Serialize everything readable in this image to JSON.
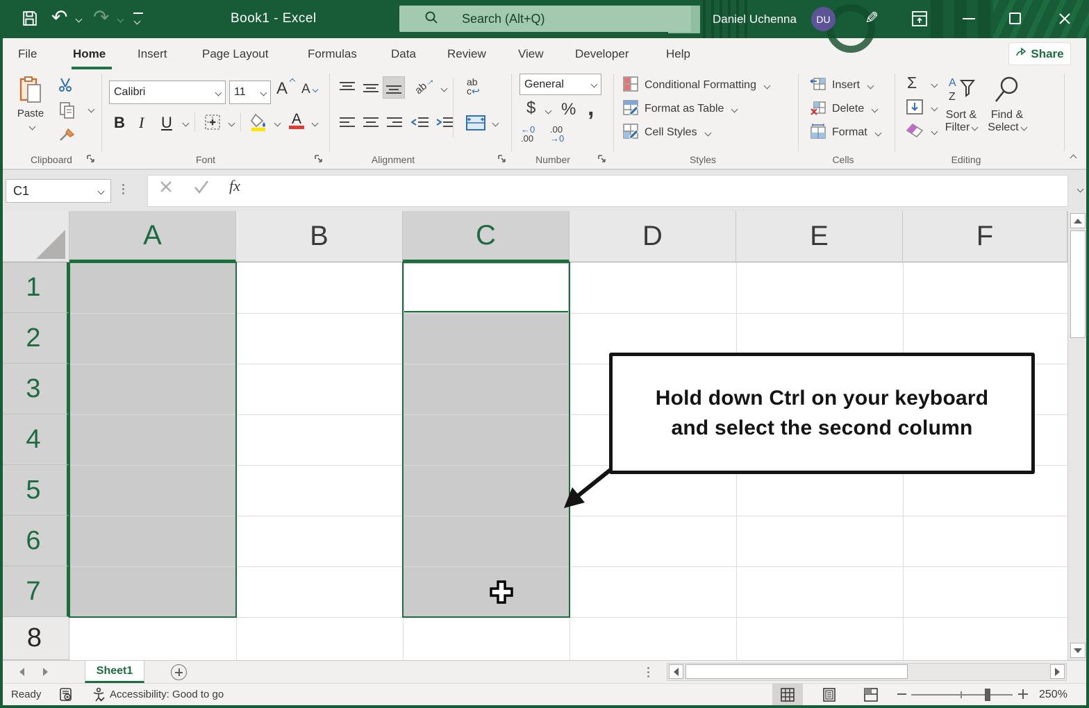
{
  "title_bar": {
    "title": "Book1  -  Excel",
    "undo_glyph": "↶",
    "redo_glyph": "↷",
    "pen_glyph": "✎",
    "search_placeholder": "Search (Alt+Q)",
    "user_name": "Daniel Uchenna",
    "avatar_initials": "DU"
  },
  "tabs": {
    "items": [
      "File",
      "Home",
      "Insert",
      "Page Layout",
      "Formulas",
      "Data",
      "Review",
      "View",
      "Developer",
      "Help"
    ],
    "active": "Home",
    "share_label": "Share"
  },
  "ribbon": {
    "clipboard": {
      "label": "Clipboard",
      "paste_label": "Paste"
    },
    "font": {
      "label": "Font",
      "name": "Calibri",
      "size": "11",
      "bold": "B",
      "italic": "I",
      "underline": "U",
      "grow": "A",
      "shrink": "A"
    },
    "alignment": {
      "label": "Alignment",
      "orient_ab": "ab",
      "wrap_l1": "ab",
      "wrap_l2": "c"
    },
    "number": {
      "label": "Number",
      "format": "General",
      "currency": "$",
      "percent": "%",
      "comma": ",",
      "inc1": "←0",
      "inc2": ".00",
      "dec1": ".00",
      "dec2": "→0"
    },
    "styles": {
      "label": "Styles",
      "conditional_formatting": "Conditional Formatting",
      "format_as_table": "Format as Table",
      "cell_styles": "Cell Styles"
    },
    "cells": {
      "label": "Cells",
      "insert": "Insert",
      "delete": "Delete",
      "format": "Format"
    },
    "editing": {
      "label": "Editing",
      "autosum": "Σ",
      "sort1": "Sort &",
      "sort2": "Filter",
      "find1": "Find &",
      "find2": "Select"
    }
  },
  "formula_bar": {
    "name_box": "C1",
    "fx": "fx"
  },
  "grid": {
    "columns": [
      "A",
      "B",
      "C",
      "D",
      "E",
      "F"
    ],
    "rows": [
      "1",
      "2",
      "3",
      "4",
      "5",
      "6",
      "7",
      "8"
    ],
    "selected_columns": [
      "A",
      "C"
    ],
    "active_cell": "C1"
  },
  "callout": {
    "line1": "Hold down Ctrl on your keyboard",
    "line2": "and select the second column"
  },
  "sheet_bar": {
    "tab": "Sheet1"
  },
  "status_bar": {
    "ready": "Ready",
    "accessibility": "Accessibility: Good to go",
    "zoom": "250%"
  },
  "colors": {
    "titlebar_green": "#185c37",
    "accent_green": "#1a6e3f",
    "selection_gray": "#cbcbcb",
    "avatar_purple": "#5d5397",
    "search_bg": "#a3c9b0"
  }
}
